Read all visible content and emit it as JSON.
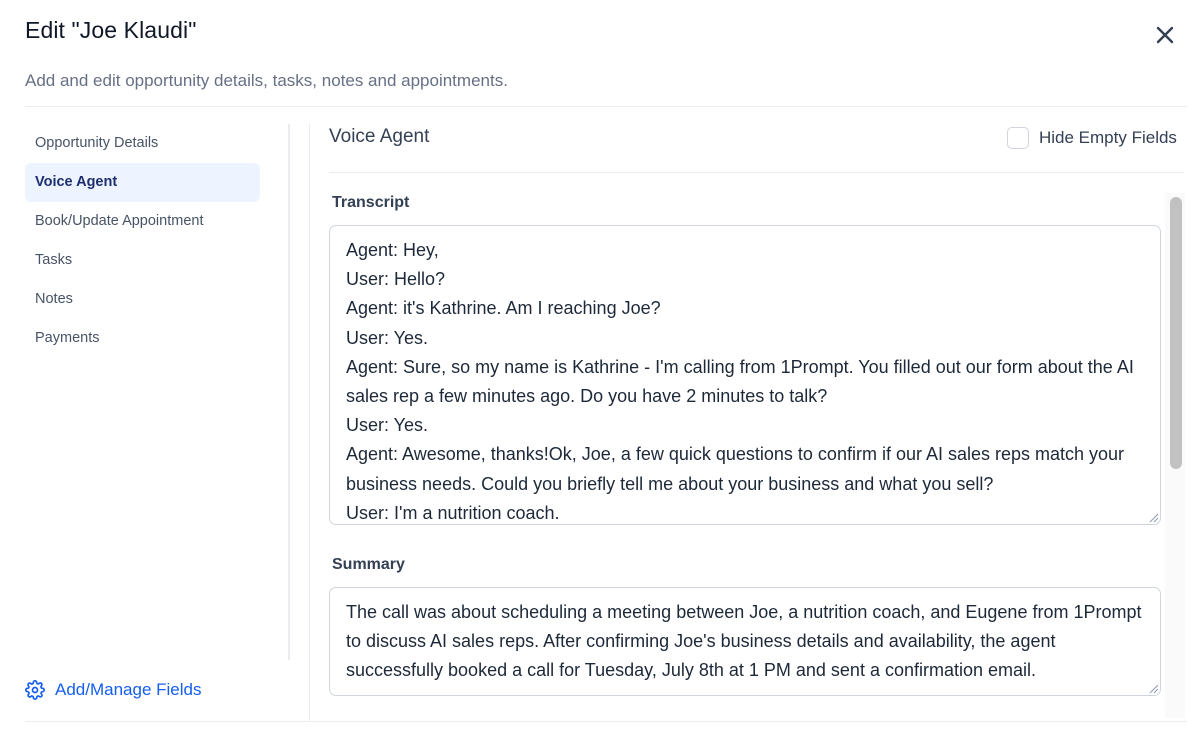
{
  "header": {
    "title": "Edit \"Joe Klaudi\"",
    "subtitle": "Add and edit opportunity details, tasks, notes and appointments."
  },
  "sidebar": {
    "items": [
      {
        "label": "Opportunity Details",
        "active": false
      },
      {
        "label": "Voice Agent",
        "active": true
      },
      {
        "label": "Book/Update Appointment",
        "active": false
      },
      {
        "label": "Tasks",
        "active": false
      },
      {
        "label": "Notes",
        "active": false
      },
      {
        "label": "Payments",
        "active": false
      }
    ],
    "add_manage_label": "Add/Manage Fields"
  },
  "main": {
    "section_title": "Voice Agent",
    "hide_empty_label": "Hide Empty Fields",
    "hide_empty_checked": false,
    "transcript_label": "Transcript",
    "transcript_value": "Agent: Hey,\nUser: Hello?\nAgent: it's Kathrine. Am I reaching Joe?\nUser: Yes.\nAgent: Sure, so my name is Kathrine - I'm calling from 1Prompt. You filled out our form about the AI sales rep a few minutes ago. Do you have 2 minutes to talk?\nUser: Yes.\nAgent: Awesome, thanks!Ok, Joe, a few quick questions to confirm if our AI sales reps match your business needs. Could you briefly tell me about your business and what you sell?\nUser: I'm a nutrition coach.",
    "summary_label": "Summary",
    "summary_value": "The call was about scheduling a meeting between Joe, a nutrition coach, and Eugene from 1Prompt to discuss AI sales reps. After confirming Joe's business details and availability, the agent successfully booked a call for Tuesday, July 8th at 1 PM and sent a confirmation email."
  },
  "colors": {
    "accent": "#155eef",
    "active_nav_bg": "#eef4ff",
    "border": "#d0d5dd"
  },
  "icons": {
    "close": "close-icon",
    "gear": "gear-icon",
    "resize": "resize-handle-icon"
  }
}
